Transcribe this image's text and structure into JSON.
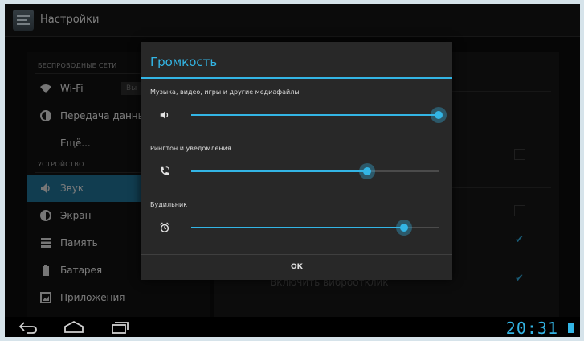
{
  "app": {
    "title": "Настройки"
  },
  "sidebar": {
    "sections": [
      {
        "header": "БЕСПРОВОДНЫЕ СЕТИ"
      },
      {
        "header": "УСТРОЙСТВО"
      }
    ],
    "items": [
      {
        "label": "Wi-Fi",
        "icon": "wifi-icon",
        "toggle": "Вы"
      },
      {
        "label": "Передача данных",
        "icon": "data-usage-icon"
      },
      {
        "label": "Ещё...",
        "icon": ""
      },
      {
        "label": "Звук",
        "icon": "sound-icon",
        "selected": true
      },
      {
        "label": "Экран",
        "icon": "display-icon"
      },
      {
        "label": "Память",
        "icon": "storage-icon"
      },
      {
        "label": "Батарея",
        "icon": "battery-icon"
      },
      {
        "label": "Приложения",
        "icon": "apps-icon"
      }
    ]
  },
  "right_pane": {
    "faded_label": "Включить виброотклик"
  },
  "dialog": {
    "title": "Громкость",
    "sliders": [
      {
        "label": "Музыка, видео, игры и другие медиафайлы",
        "icon": "speaker-icon",
        "level": 1.0
      },
      {
        "label": "Рингтон и уведомления",
        "icon": "ringtone-icon",
        "level": 0.71
      },
      {
        "label": "Будильник",
        "icon": "alarm-icon",
        "level": 0.86
      }
    ],
    "ok_label": "ОК"
  },
  "status": {
    "clock": "20:31"
  },
  "colors": {
    "accent": "#33b5e5",
    "selected": "#1f6f93"
  }
}
